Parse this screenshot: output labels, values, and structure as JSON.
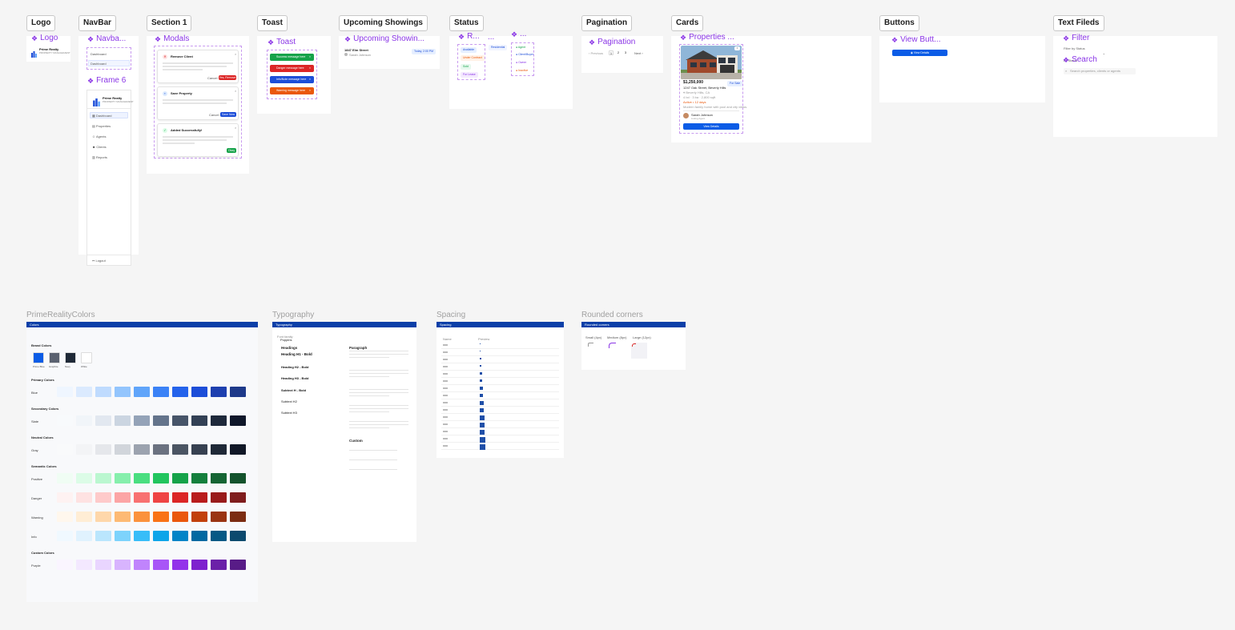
{
  "sections": {
    "logo": "Logo",
    "navbar": "NavBar",
    "section1": "Section 1",
    "toast": "Toast",
    "upcoming": "Upcoming Showings",
    "status": "Status",
    "pagination": "Pagination",
    "cards": "Cards",
    "buttons": "Buttons",
    "textfields": "Text Fileds"
  },
  "components": {
    "logo": "Logo",
    "navbar": "Navba...",
    "frame6": "Frame 6",
    "modals": "Modals",
    "toast": "Toast",
    "upcoming": "Upcoming Showin...",
    "status_r": "R...",
    "status_dots1": "...",
    "status_dots2": "...",
    "pagination": "Pagination",
    "properties": "Properties ...",
    "view_button": "View Butt...",
    "filter": "Filter",
    "search": "Search"
  },
  "logo": {
    "name": "Prime Realty",
    "tagline": "PROPERTY MANAGEMENT"
  },
  "navbar": {
    "items_small": [
      "Dashboard",
      "Dashboard"
    ],
    "items": [
      "Dashboard",
      "Properties",
      "Agents",
      "Clients",
      "Reports"
    ],
    "logout": "Logout"
  },
  "modals": {
    "remove_title": "Remove Client",
    "remove_cancel": "Cancel",
    "remove_confirm": "Yes, Remove",
    "save_title": "Save Property",
    "save_cancel": "Cancel",
    "save_confirm": "Save Now",
    "added_title": "Added Successfully!",
    "added_ok": "Okay"
  },
  "toasts": [
    {
      "text": "Success message here",
      "color": "#16a34a"
    },
    {
      "text": "Danger message here",
      "color": "#dc2626"
    },
    {
      "text": "Info/Note message here",
      "color": "#1d4ed8"
    },
    {
      "text": "Warning message here",
      "color": "#ea580c"
    }
  ],
  "upcoming": {
    "address": "1847 Elm Street",
    "client": "Sarah Johnson",
    "badge": "Today, 2:00 PM"
  },
  "status": {
    "col1": [
      "Available",
      "Under Contract",
      "Sold",
      "For Lease"
    ],
    "col2": [
      "Residential"
    ],
    "col3": [
      "Agent",
      "Client/Buyer",
      "Owner",
      "Inactive"
    ]
  },
  "pagination": {
    "prev": "Previous",
    "pages": [
      "1",
      "2",
      "3"
    ],
    "next": "Next"
  },
  "card": {
    "price": "$1,250,000",
    "address": "1247 Oak Street, Beverly Hills",
    "badge": "For Sale",
    "location": "Beverly Hills, CA",
    "specs": "4 bd · 3 ba · 2,800 sqft",
    "status": "Active • 12 days",
    "desc": "Modern family home with pool and city views.",
    "agent": "Sarah Johnson",
    "agent_role": "Listing Agent",
    "button": "View Details"
  },
  "buttons": {
    "view_details": "View Details"
  },
  "textfields": {
    "filter_label": "Filter by Status",
    "filter_value": "All Status",
    "search_placeholder": "Search properties, clients or agents"
  },
  "frames": {
    "colors": "PrimeRealityColors",
    "typography": "Typography",
    "spacing": "Spacing",
    "corners": "Rounded corners"
  },
  "colors_panel": {
    "bar": "Colors",
    "brand": "Brand Colors",
    "brand_swatches": [
      {
        "name": "Prime Blue",
        "color": "#0b5ce6"
      },
      {
        "name": "Graphite",
        "color": "#5b6270"
      },
      {
        "name": "Navy",
        "color": "#1f2937"
      },
      {
        "name": "White",
        "color": "#ffffff"
      }
    ],
    "groups": [
      {
        "title": "Primary Colors",
        "rows": [
          {
            "label": "Blue",
            "colors": [
              "#eff6ff",
              "#dbeafe",
              "#bfdbfe",
              "#93c5fd",
              "#60a5fa",
              "#3b82f6",
              "#2563eb",
              "#1d4ed8",
              "#1e40af",
              "#1e3a8a"
            ]
          }
        ]
      },
      {
        "title": "Secondary Colors",
        "rows": [
          {
            "label": "Slate",
            "colors": [
              "#f8fafc",
              "#f1f5f9",
              "#e2e8f0",
              "#cbd5e1",
              "#94a3b8",
              "#64748b",
              "#475569",
              "#334155",
              "#1e293b",
              "#0f172a"
            ]
          }
        ]
      },
      {
        "title": "Neutral Colors",
        "rows": [
          {
            "label": "Gray",
            "colors": [
              "#f9fafb",
              "#f3f4f6",
              "#e5e7eb",
              "#d1d5db",
              "#9ca3af",
              "#6b7280",
              "#4b5563",
              "#374151",
              "#1f2937",
              "#111827"
            ]
          }
        ]
      },
      {
        "title": "Semantic Colors",
        "rows": [
          {
            "label": "Positive",
            "colors": [
              "#f0fdf4",
              "#dcfce7",
              "#bbf7d0",
              "#86efac",
              "#4ade80",
              "#22c55e",
              "#16a34a",
              "#15803d",
              "#166534",
              "#14532d"
            ]
          },
          {
            "label": "Danger",
            "colors": [
              "#fef2f2",
              "#fee2e2",
              "#fecaca",
              "#fca5a5",
              "#f87171",
              "#ef4444",
              "#dc2626",
              "#b91c1c",
              "#991b1b",
              "#7f1d1d"
            ]
          },
          {
            "label": "Warning",
            "colors": [
              "#fff7ed",
              "#ffedd5",
              "#fed7aa",
              "#fdba74",
              "#fb923c",
              "#f97316",
              "#ea580c",
              "#c2410c",
              "#9a3412",
              "#7c2d12"
            ]
          },
          {
            "label": "Info",
            "colors": [
              "#f0f9ff",
              "#e0f2fe",
              "#bae6fd",
              "#7dd3fc",
              "#38bdf8",
              "#0ea5e9",
              "#0284c7",
              "#0369a1",
              "#075985",
              "#0c4a6e"
            ]
          }
        ]
      },
      {
        "title": "Custom Colors",
        "rows": [
          {
            "label": "Purple",
            "colors": [
              "#faf5ff",
              "#f3e8ff",
              "#e9d5ff",
              "#d8b4fe",
              "#c084fc",
              "#a855f7",
              "#9333ea",
              "#7e22ce",
              "#6b21a8",
              "#581c87"
            ]
          }
        ]
      }
    ]
  },
  "typography_panel": {
    "bar": "Typography",
    "font": "Font family",
    "font_name": "Poppins",
    "headings": "Headings",
    "h1": "Heading H1 - Bold",
    "h2": "Heading H2 - Bold",
    "h3": "Heading H3 - Bold",
    "h4": "Subtext H - Bold",
    "h5": "Subtext H2",
    "h6": "Subtext H3",
    "paragraph": "Paragraph",
    "custom": "Custom"
  },
  "spacing_panel": {
    "bar": "Spacing",
    "col1": "Name",
    "col2": "Preview"
  },
  "corners_panel": {
    "bar": "Rounded corners",
    "labels": [
      "Small (4px)",
      "Medium (8px)",
      "Large (12px)"
    ]
  }
}
